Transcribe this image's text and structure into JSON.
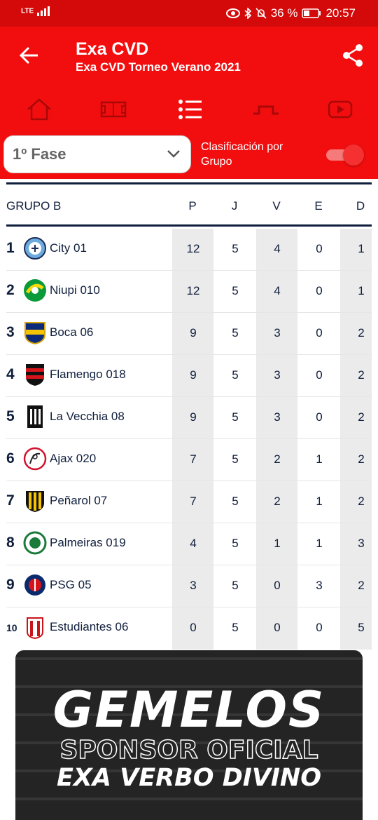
{
  "statusbar": {
    "network": "LTE",
    "battery": "36 %",
    "time": "20:57"
  },
  "header": {
    "title": "Exa CVD",
    "subtitle": "Exa CVD Torneo Verano 2021",
    "nav_icons": [
      "home-icon",
      "field-icon",
      "list-icon",
      "goal-icon",
      "youtube-icon"
    ],
    "selected_nav": "list-icon"
  },
  "filters": {
    "phase": "1º Fase",
    "group_toggle_label": "Clasificación por Grupo",
    "group_toggle_on": true
  },
  "table": {
    "group": "GRUPO B",
    "columns": [
      "P",
      "J",
      "V",
      "E",
      "D"
    ],
    "rows": [
      {
        "pos": "1",
        "team": "City 01",
        "P": "12",
        "J": "5",
        "V": "4",
        "E": "0",
        "D": "1",
        "logo": "manchester-city-crest"
      },
      {
        "pos": "2",
        "team": "Niupi 010",
        "P": "12",
        "J": "5",
        "V": "4",
        "E": "0",
        "D": "1",
        "logo": "niupi-crest"
      },
      {
        "pos": "3",
        "team": "Boca 06",
        "P": "9",
        "J": "5",
        "V": "3",
        "E": "0",
        "D": "2",
        "logo": "boca-crest"
      },
      {
        "pos": "4",
        "team": "Flamengo 018",
        "P": "9",
        "J": "5",
        "V": "3",
        "E": "0",
        "D": "2",
        "logo": "flamengo-crest"
      },
      {
        "pos": "5",
        "team": "La Vecchia 08",
        "P": "9",
        "J": "5",
        "V": "3",
        "E": "0",
        "D": "2",
        "logo": "juventus-crest"
      },
      {
        "pos": "6",
        "team": "Ajax 020",
        "P": "7",
        "J": "5",
        "V": "2",
        "E": "1",
        "D": "2",
        "logo": "ajax-crest"
      },
      {
        "pos": "7",
        "team": "Peñarol 07",
        "P": "7",
        "J": "5",
        "V": "2",
        "E": "1",
        "D": "2",
        "logo": "penarol-crest"
      },
      {
        "pos": "8",
        "team": "Palmeiras 019",
        "P": "4",
        "J": "5",
        "V": "1",
        "E": "1",
        "D": "3",
        "logo": "palmeiras-crest"
      },
      {
        "pos": "9",
        "team": "PSG 05",
        "P": "3",
        "J": "5",
        "V": "0",
        "E": "3",
        "D": "2",
        "logo": "psg-crest"
      },
      {
        "pos": "10",
        "team": "Estudiantes 06",
        "P": "0",
        "J": "5",
        "V": "0",
        "E": "0",
        "D": "5",
        "logo": "estudiantes-crest"
      }
    ]
  },
  "banner": {
    "brand": "GEMELOS",
    "line1": "SPONSOR OFICIAL",
    "line2": "EXA VERBO DIVINO"
  },
  "colors": {
    "header_red": "#f20e0e",
    "statusbar_red": "#d40a0a",
    "navy": "#0f1e3c",
    "shaded_column": "#ebebeb"
  }
}
